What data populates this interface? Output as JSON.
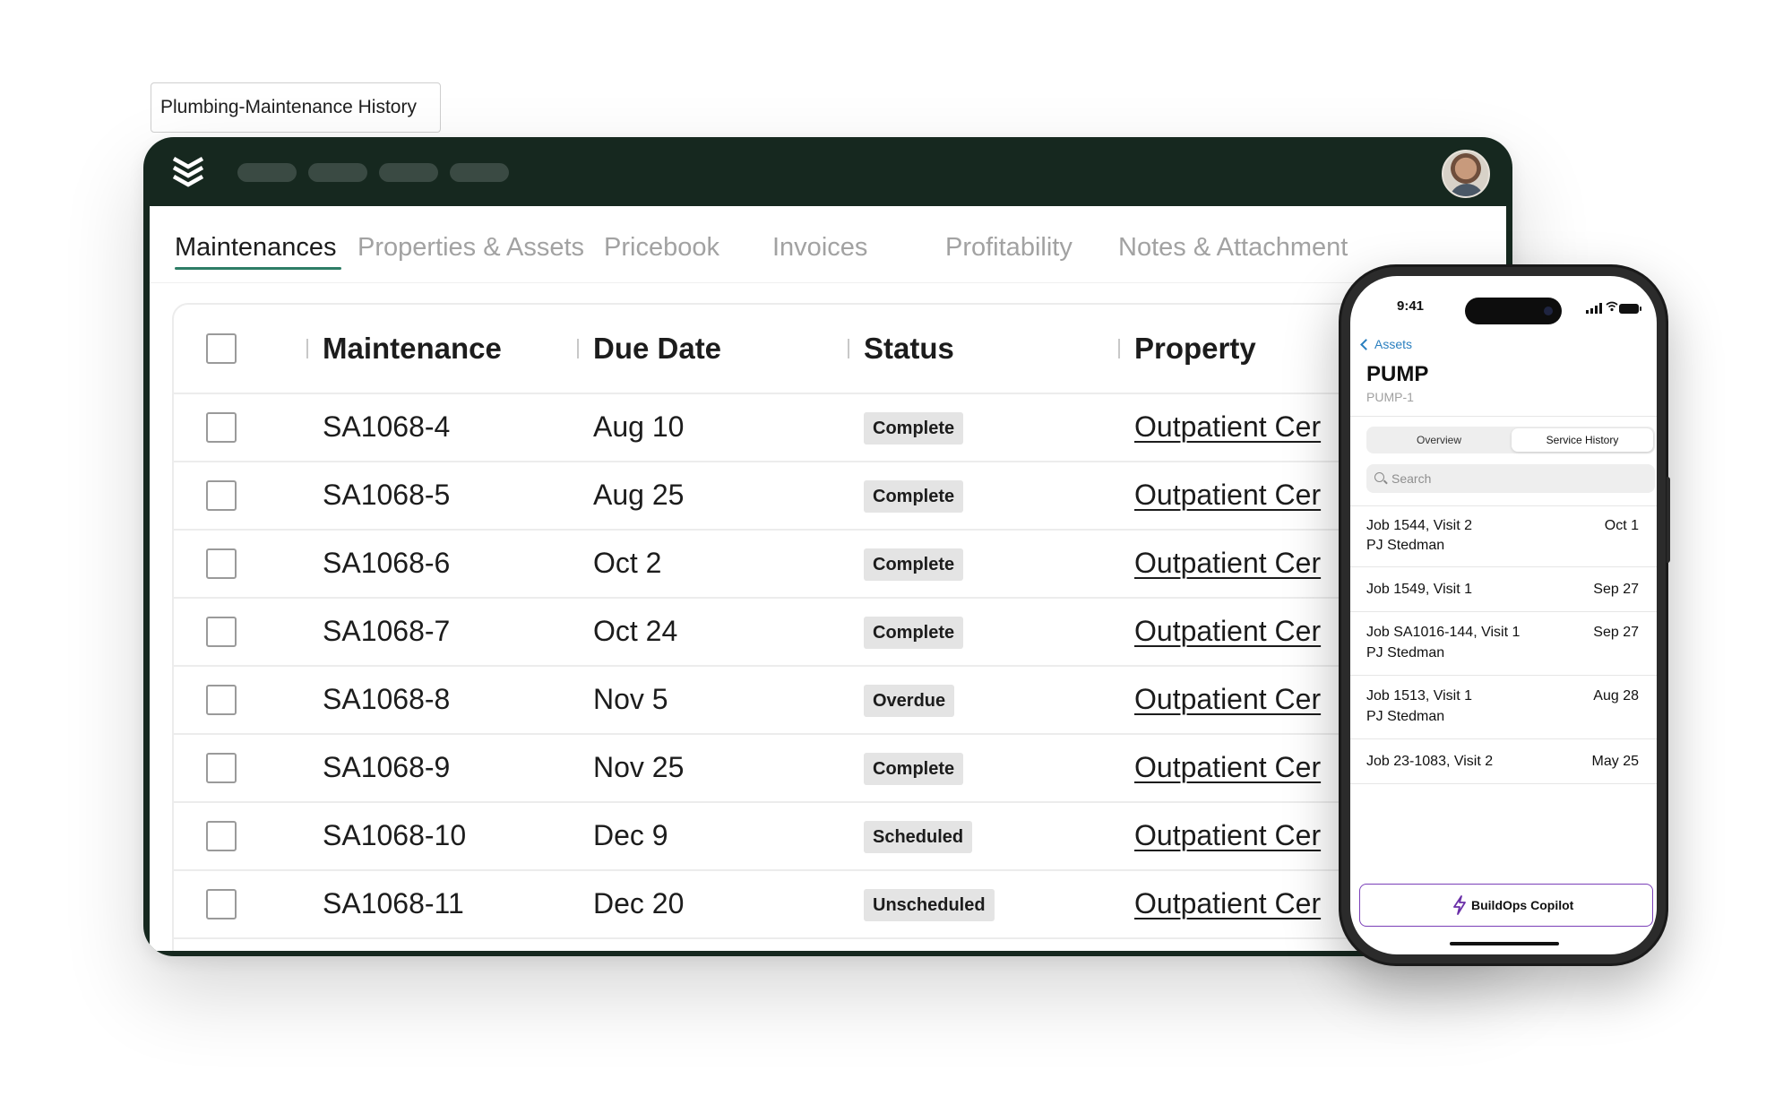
{
  "label_tag": "Plumbing-Maintenance History",
  "tabs": [
    "Maintenances",
    "Properties & Assets",
    "Pricebook",
    "Invoices",
    "Profitability",
    "Notes & Attachment"
  ],
  "active_tab": "Maintenances",
  "table": {
    "headers": [
      "Maintenance",
      "Due Date",
      "Status",
      "Property"
    ],
    "rows": [
      {
        "id": "SA1068-4",
        "due": "Aug 10",
        "status": "Complete",
        "property": "Outpatient Cer"
      },
      {
        "id": "SA1068-5",
        "due": "Aug 25",
        "status": "Complete",
        "property": "Outpatient Cer"
      },
      {
        "id": "SA1068-6",
        "due": "Oct 2",
        "status": "Complete",
        "property": "Outpatient Cer"
      },
      {
        "id": "SA1068-7",
        "due": "Oct 24",
        "status": "Complete",
        "property": "Outpatient Cer"
      },
      {
        "id": "SA1068-8",
        "due": "Nov 5",
        "status": "Overdue",
        "property": "Outpatient Cer"
      },
      {
        "id": "SA1068-9",
        "due": "Nov 25",
        "status": "Complete",
        "property": "Outpatient Cer"
      },
      {
        "id": "SA1068-10",
        "due": "Dec 9",
        "status": "Scheduled",
        "property": "Outpatient Cer"
      },
      {
        "id": "SA1068-11",
        "due": "Dec 20",
        "status": "Unscheduled",
        "property": "Outpatient Cer"
      }
    ]
  },
  "phone": {
    "time": "9:41",
    "back_label": "Assets",
    "asset_title": "PUMP",
    "asset_sub": "PUMP-1",
    "segments": [
      "Overview",
      "Service History"
    ],
    "active_segment": "Service History",
    "search_placeholder": "Search",
    "jobs": [
      {
        "title": "Job 1544, Visit 2",
        "tech": "PJ Stedman",
        "date": "Oct 1"
      },
      {
        "title": "Job 1549, Visit 1",
        "tech": "",
        "date": "Sep 27"
      },
      {
        "title": "Job SA1016-144, Visit 1",
        "tech": "PJ Stedman",
        "date": "Sep 27"
      },
      {
        "title": "Job 1513, Visit 1",
        "tech": "PJ Stedman",
        "date": "Aug 28"
      },
      {
        "title": "Job 23-1083, Visit 2",
        "tech": "",
        "date": "May 25"
      }
    ],
    "copilot_label": "BuildOps Copilot"
  },
  "colors": {
    "app_bar": "#16281f",
    "tab_underline": "#2e7d66",
    "copilot_border": "#7a3fb8",
    "link_blue": "#2a7fbf"
  },
  "icons": [
    "buildops-logo-icon",
    "avatar",
    "chevron-left-icon",
    "search-icon",
    "bolt-icon",
    "signal-icon",
    "wifi-icon",
    "battery-icon"
  ]
}
